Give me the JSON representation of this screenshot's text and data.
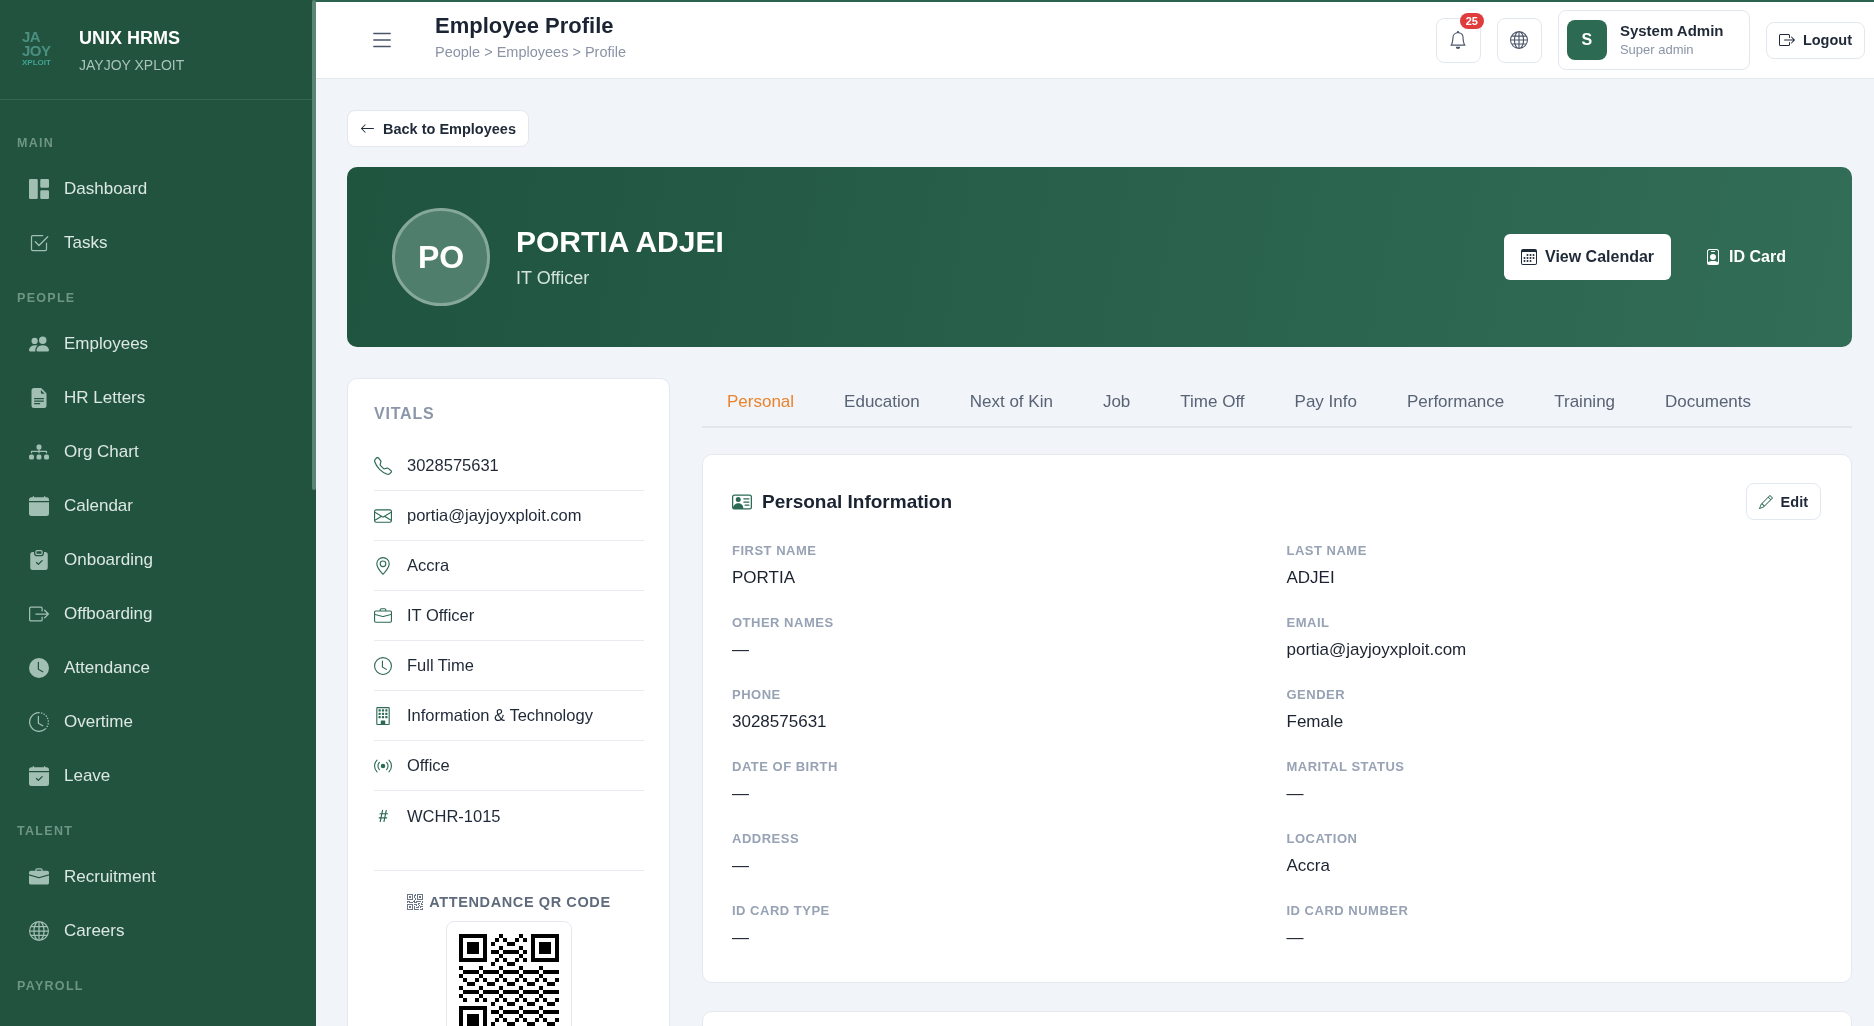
{
  "sidebar": {
    "logo": [
      "JA",
      "JOY",
      "XPLOIT"
    ],
    "title": "UNIX HRMS",
    "subtitle": "JAYJOY XPLOIT",
    "sections": [
      {
        "label": "MAIN",
        "items": [
          "Dashboard",
          "Tasks"
        ]
      },
      {
        "label": "PEOPLE",
        "items": [
          "Employees",
          "HR Letters",
          "Org Chart",
          "Calendar",
          "Onboarding",
          "Offboarding",
          "Attendance",
          "Overtime",
          "Leave"
        ]
      },
      {
        "label": "TALENT",
        "items": [
          "Recruitment",
          "Careers"
        ]
      },
      {
        "label": "PAYROLL"
      }
    ]
  },
  "header": {
    "title": "Employee Profile",
    "breadcrumb": "People > Employees > Profile",
    "notifications": "25",
    "user": {
      "initial": "S",
      "name": "System Admin",
      "role": "Super admin"
    },
    "logout": "Logout"
  },
  "back_button": "Back to Employees",
  "profile": {
    "initials": "PO",
    "name": "PORTIA ADJEI",
    "job_title": "IT Officer",
    "actions": [
      {
        "label": "View Calendar",
        "kind": "primary"
      },
      {
        "label": "ID Card",
        "kind": "ghost"
      }
    ]
  },
  "vitals": {
    "title": "VITALS",
    "items": [
      "3028575631",
      "portia@jayjoyxploit.com",
      "Accra",
      "IT Officer",
      "Full Time",
      "Information & Technology",
      "Office",
      "WCHR-1015"
    ],
    "qr_title": "ATTENDANCE QR CODE"
  },
  "tabs": [
    {
      "label": "Personal",
      "selected": true
    },
    {
      "label": "Education",
      "selected": false
    },
    {
      "label": "Next of Kin",
      "selected": false
    },
    {
      "label": "Job",
      "selected": false
    },
    {
      "label": "Time Off",
      "selected": false
    },
    {
      "label": "Pay Info",
      "selected": false
    },
    {
      "label": "Performance",
      "selected": false
    },
    {
      "label": "Training",
      "selected": false
    },
    {
      "label": "Documents",
      "selected": false
    }
  ],
  "personal_info": {
    "title": "Personal Information",
    "edit": "Edit",
    "fields": [
      {
        "label": "FIRST NAME",
        "value": "PORTIA"
      },
      {
        "label": "LAST NAME",
        "value": "ADJEI"
      },
      {
        "label": "OTHER NAMES",
        "value": "—"
      },
      {
        "label": "EMAIL",
        "value": "portia@jayjoyxploit.com"
      },
      {
        "label": "PHONE",
        "value": "3028575631"
      },
      {
        "label": "GENDER",
        "value": "Female"
      },
      {
        "label": "DATE OF BIRTH",
        "value": "—"
      },
      {
        "label": "MARITAL STATUS",
        "value": "—"
      },
      {
        "label": "ADDRESS",
        "value": "—"
      },
      {
        "label": "LOCATION",
        "value": "Accra"
      },
      {
        "label": "ID CARD TYPE",
        "value": "—"
      },
      {
        "label": "ID CARD NUMBER",
        "value": "—"
      }
    ]
  }
}
